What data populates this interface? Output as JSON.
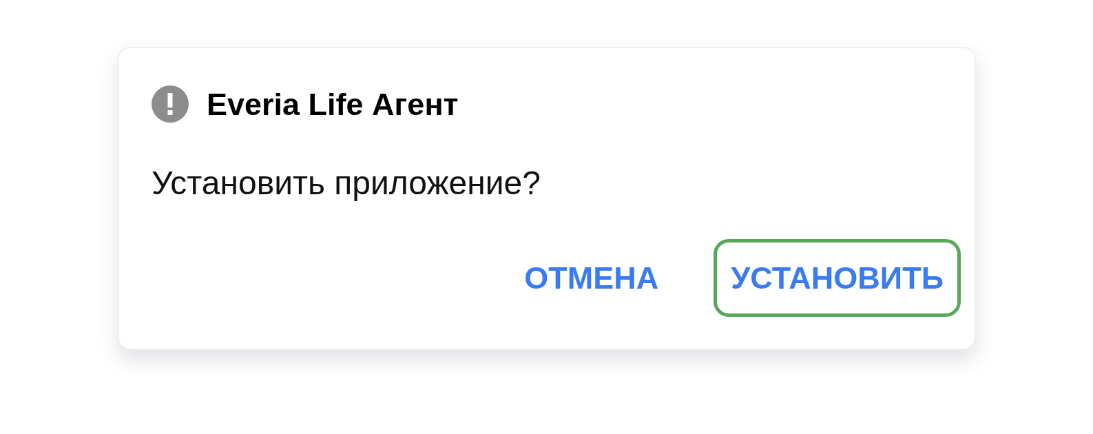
{
  "dialog": {
    "title": "Everia Life Агент",
    "message": "Установить приложение?",
    "buttons": [
      {
        "label": "ОТМЕНА",
        "focused": false
      },
      {
        "label": "УСТАНОВИТЬ",
        "focused": true
      }
    ]
  }
}
